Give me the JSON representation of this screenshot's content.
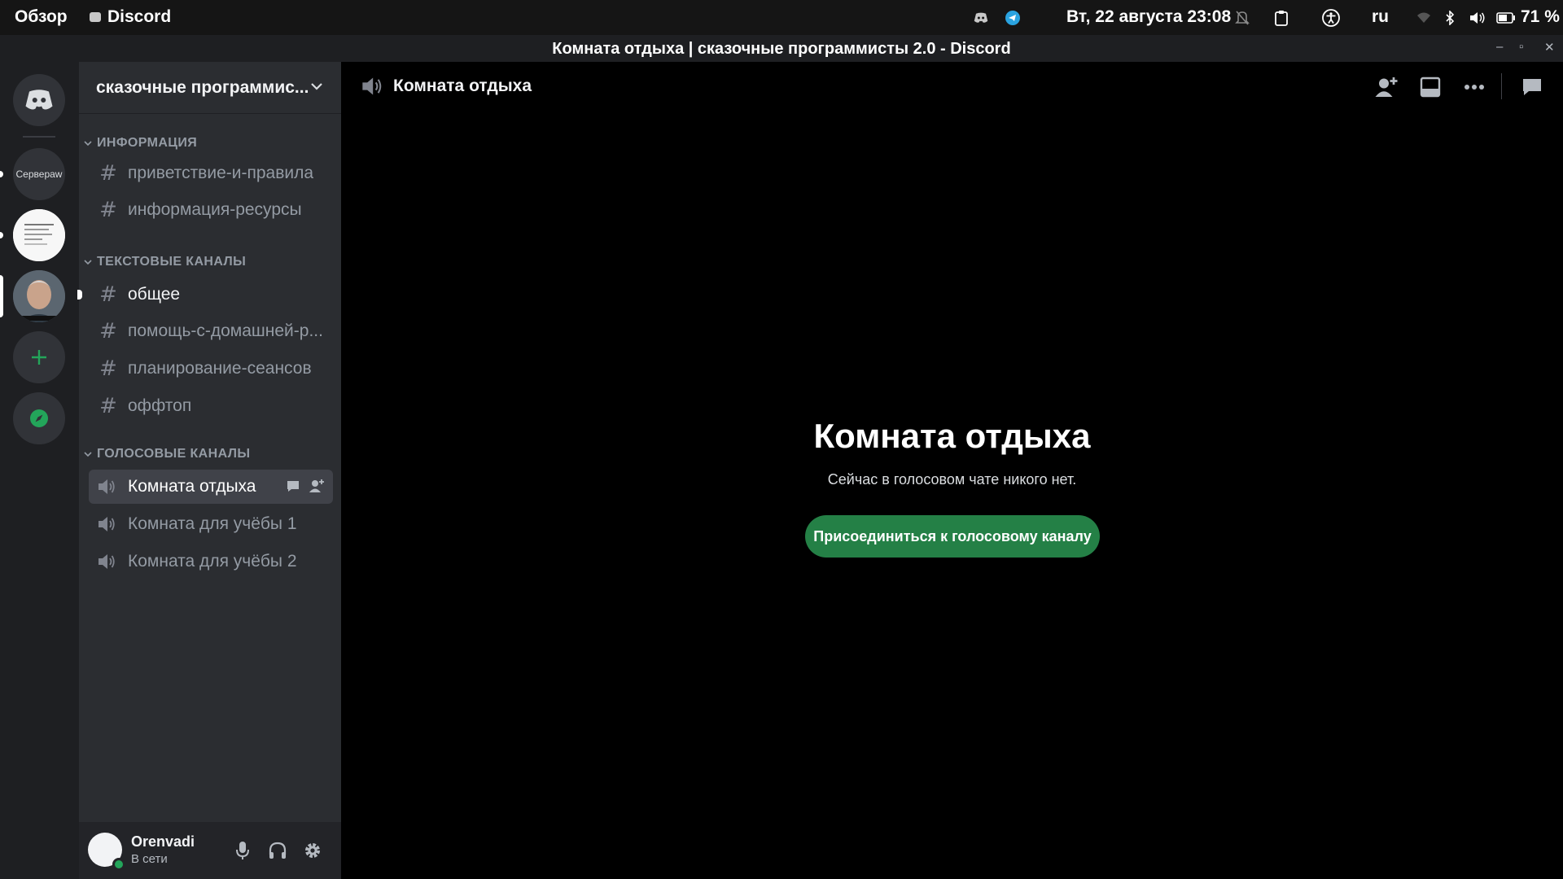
{
  "topbar": {
    "overview": "Обзор",
    "app_name": "Discord",
    "date": "Вт, 22 августа  23:08",
    "lang": "ru",
    "battery": "71 %"
  },
  "window": {
    "title": "Комната отдыха | сказочные программисты 2.0 - Discord"
  },
  "rail": {
    "servers_folder_label": "Серверaw"
  },
  "guild": {
    "name": "сказочные программис..."
  },
  "categories": [
    {
      "name": "ИНФОРМАЦИЯ",
      "channels": [
        {
          "name": "приветствие-и-правила"
        },
        {
          "name": "информация-ресурсы"
        }
      ]
    },
    {
      "name": "ТЕКСТОВЫЕ КАНАЛЫ",
      "channels": [
        {
          "name": "общее"
        },
        {
          "name": "помощь-с-домашней-р..."
        },
        {
          "name": "планирование-сеансов"
        },
        {
          "name": "оффтоп"
        }
      ]
    },
    {
      "name": "ГОЛОСОВЫЕ КАНАЛЫ",
      "channels": [
        {
          "name": "Комната отдыха"
        },
        {
          "name": "Комната для учёбы 1"
        },
        {
          "name": "Комната для учёбы 2"
        }
      ]
    }
  ],
  "user": {
    "name": "Orenvadi",
    "status": "В сети"
  },
  "main": {
    "channel_name": "Комната отдыха",
    "title": "Комната отдыха",
    "subtitle": "Сейчас в голосовом чате никого нет.",
    "join_label": "Присоединиться к голосовому каналу"
  },
  "colors": {
    "accent_green": "#248046",
    "online": "#23a55a",
    "sidebar": "#2b2d31",
    "rail": "#1e1f22"
  }
}
